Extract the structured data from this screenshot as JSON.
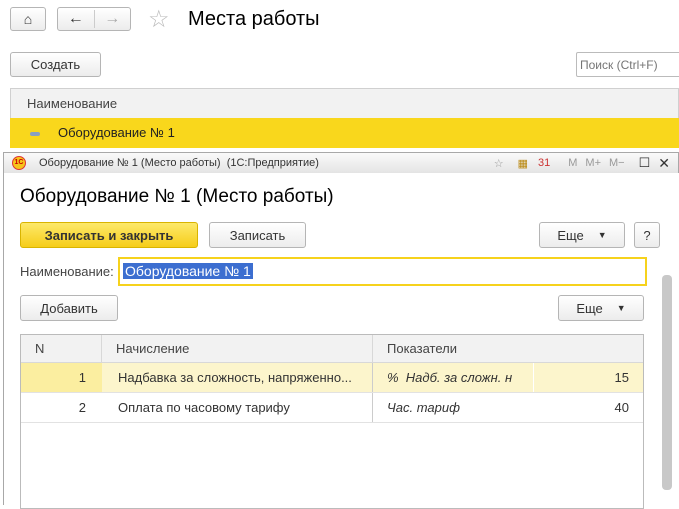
{
  "list": {
    "title": "Места работы",
    "create_label": "Создать",
    "search_placeholder": "Поиск (Ctrl+F)",
    "column": "Наименование",
    "rows": [
      {
        "name": "Оборудование № 1"
      }
    ]
  },
  "form": {
    "window_title": "Оборудование № 1 (Место работы)  (1С:Предприятие)",
    "toolbar_icons": {
      "m": "M",
      "mplus": "M+",
      "mminus": "M−",
      "calendar": "31"
    },
    "heading": "Оборудование № 1 (Место работы)",
    "save_close_label": "Записать и закрыть",
    "save_label": "Записать",
    "more_label": "Еще",
    "help_label": "?",
    "name_label": "Наименование:",
    "name_value": "Оборудование № 1",
    "add_label": "Добавить",
    "table_more_label": "Еще",
    "table": {
      "headers": [
        "N",
        "Начисление",
        "Показатели"
      ],
      "rows": [
        {
          "n": "1",
          "accrual": "Надбавка за сложность, напряженно...",
          "indicator": "%  Надб. за сложн. н",
          "value": "15"
        },
        {
          "n": "2",
          "accrual": "Оплата по часовому тарифу",
          "indicator": "Час. тариф",
          "value": "40"
        }
      ]
    }
  },
  "colors": {
    "accent": "#f9d71c",
    "selected_row": "#fcf5cc"
  }
}
